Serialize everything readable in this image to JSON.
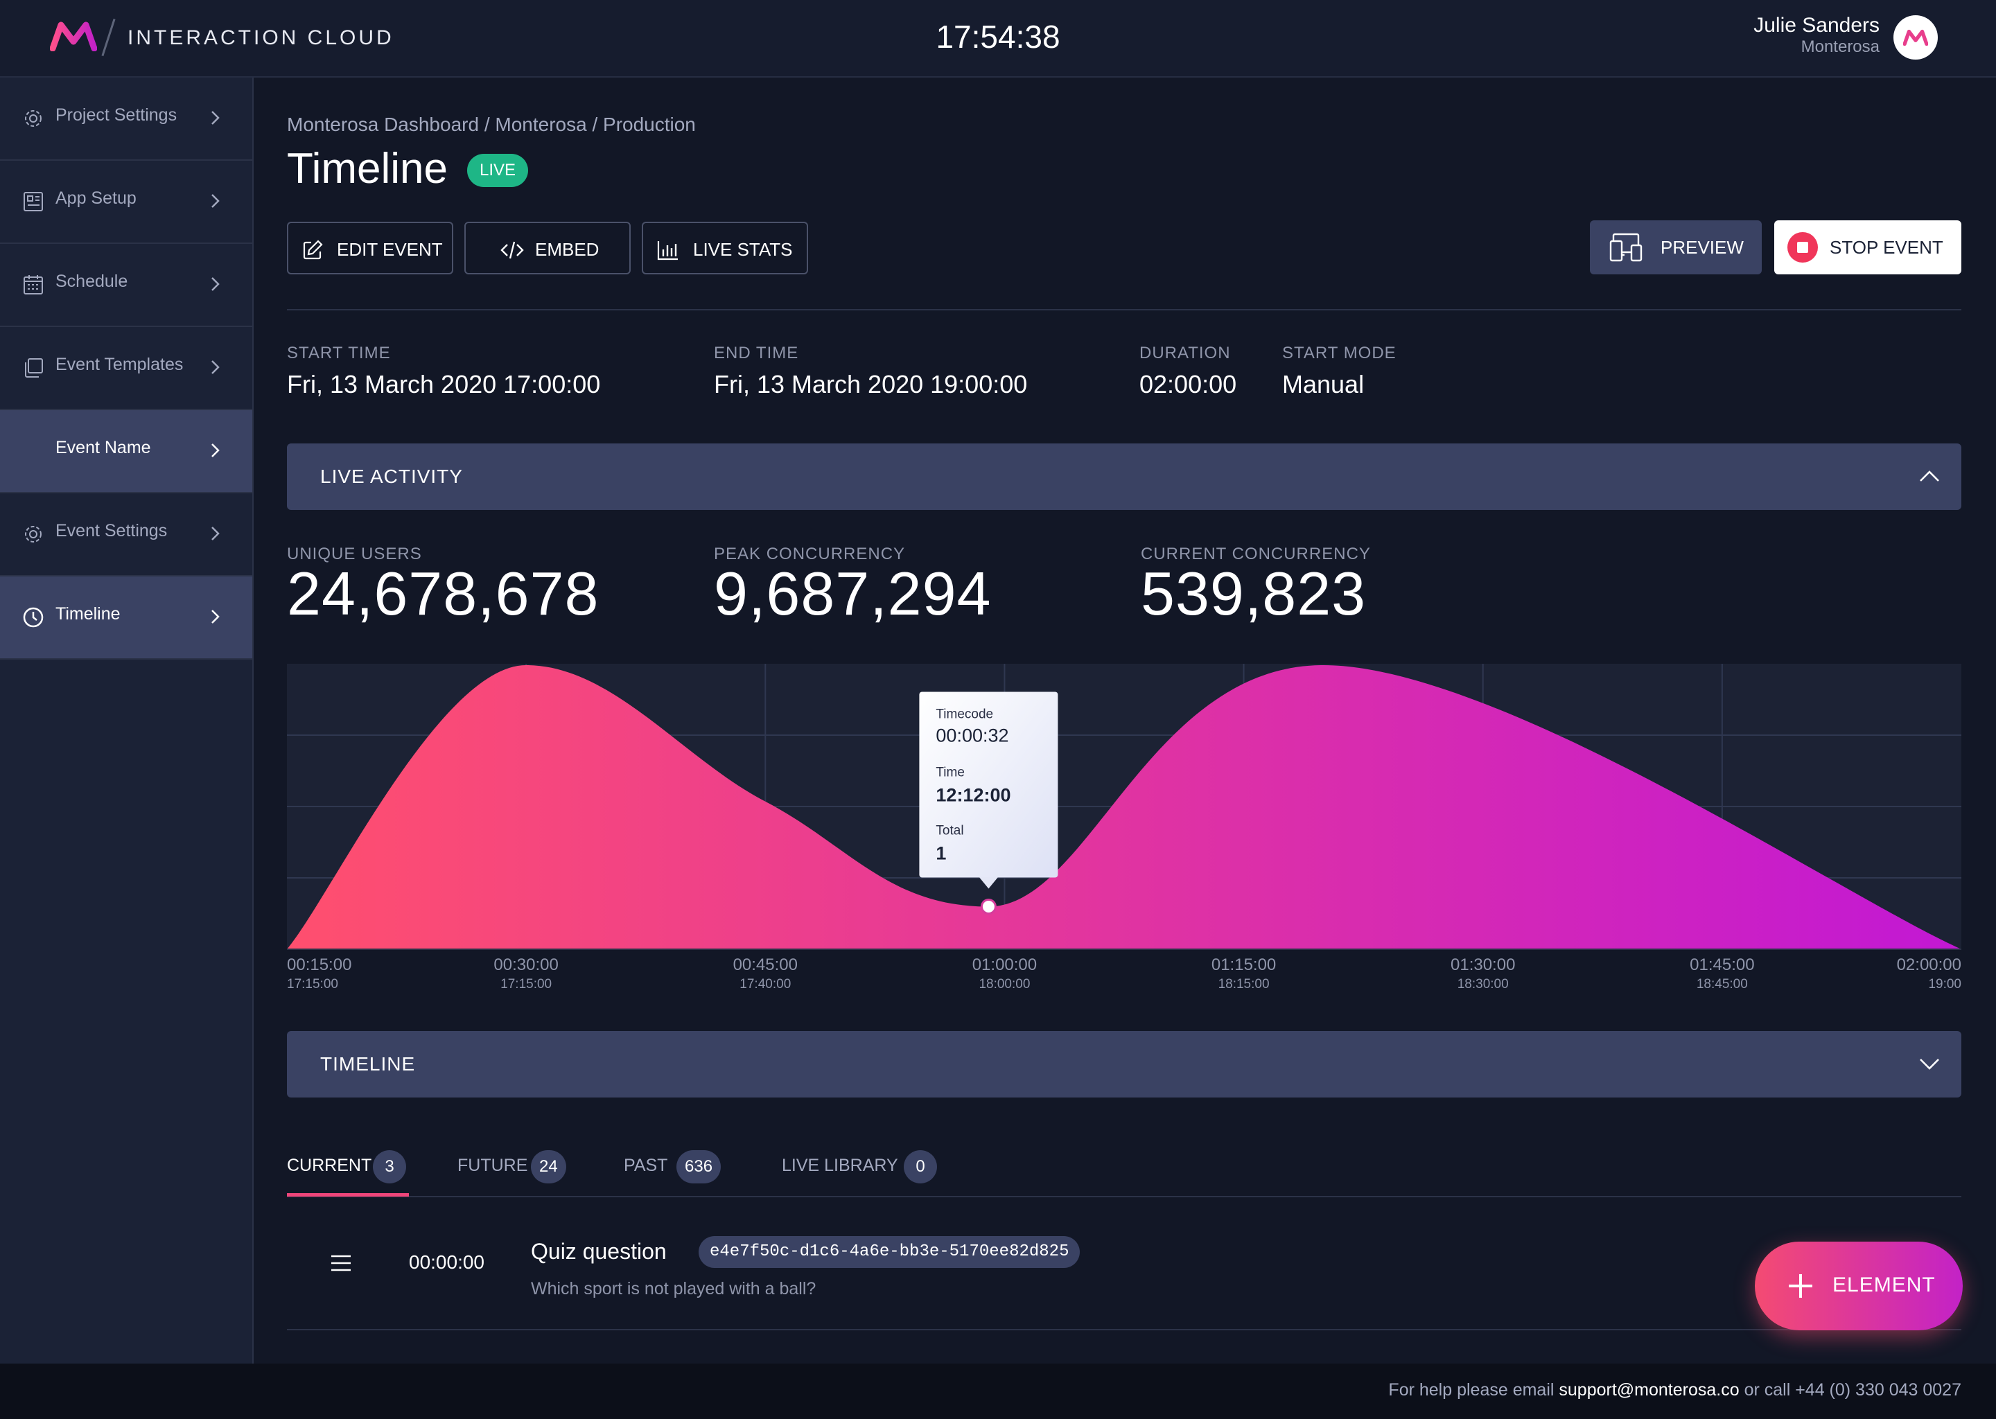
{
  "header": {
    "brand": "INTERACTION CLOUD",
    "clock": "17:54:38",
    "user_name": "Julie Sanders",
    "user_org": "Monterosa",
    "icons": {
      "logo": "monterosa-m-logo",
      "avatar": "monterosa-avatar"
    }
  },
  "sidebar": {
    "items": [
      {
        "label": "Project Settings",
        "icon": "gear-icon"
      },
      {
        "label": "App Setup",
        "icon": "app-setup-icon"
      },
      {
        "label": "Schedule",
        "icon": "calendar-icon"
      },
      {
        "label": "Event Templates",
        "icon": "templates-icon"
      },
      {
        "label": "Event Name",
        "icon": ""
      },
      {
        "label": "Event Settings",
        "icon": "gear-icon"
      },
      {
        "label": "Timeline",
        "icon": "clock-icon"
      }
    ]
  },
  "main": {
    "breadcrumb": "Monterosa Dashboard / Monterosa / Production",
    "title": "Timeline",
    "status_badge": "LIVE",
    "buttons": {
      "edit_event": "EDIT EVENT",
      "embed": "EMBED",
      "live_stats": "LIVE STATS",
      "preview": "PREVIEW",
      "stop_event": "STOP EVENT"
    },
    "meta": {
      "start_time_label": "START TIME",
      "start_time": "Fri, 13 March 2020 17:00:00",
      "end_time_label": "END TIME",
      "end_time": "Fri, 13 March 2020 19:00:00",
      "duration_label": "DURATION",
      "duration": "02:00:00",
      "start_mode_label": "START MODE",
      "start_mode": "Manual"
    },
    "live_activity": {
      "title": "LIVE ACTIVITY",
      "unique_users_label": "UNIQUE USERS",
      "unique_users": "24,678,678",
      "peak_label": "PEAK CONCURRENCY",
      "peak": "9,687,294",
      "current_label": "CURRENT CONCURRENCY",
      "current": "539,823"
    },
    "timeline_panel": {
      "title": "TIMELINE"
    },
    "tabs": [
      {
        "label": "CURRENT",
        "count": "3"
      },
      {
        "label": "FUTURE",
        "count": "24"
      },
      {
        "label": "PAST",
        "count": "636"
      },
      {
        "label": "LIVE LIBRARY",
        "count": "0"
      }
    ],
    "rows": [
      {
        "time": "00:00:00",
        "title": "Quiz question",
        "id": "e4e7f50c-d1c6-4a6e-bb3e-5170ee82d825",
        "subtitle": "Which sport is not played with a ball?"
      }
    ],
    "fab_label": "ELEMENT"
  },
  "chart_data": {
    "type": "area",
    "x_ticks": [
      {
        "label": "00:15:00",
        "sub": "17:15:00"
      },
      {
        "label": "00:30:00",
        "sub": "17:15:00"
      },
      {
        "label": "00:45:00",
        "sub": "17:40:00"
      },
      {
        "label": "01:00:00",
        "sub": "18:00:00"
      },
      {
        "label": "01:15:00",
        "sub": "18:15:00"
      },
      {
        "label": "01:30:00",
        "sub": "18:30:00"
      },
      {
        "label": "01:45:00",
        "sub": "18:45:00"
      },
      {
        "label": "02:00:00",
        "sub": "19:00"
      }
    ],
    "x_minutes": [
      15,
      30,
      45,
      60,
      75,
      90,
      105,
      120
    ],
    "series_relative": [
      {
        "x": 15,
        "y": 0
      },
      {
        "x": 30,
        "y": 1.0
      },
      {
        "x": 45,
        "y": 0.52
      },
      {
        "x": 59,
        "y": 0.15
      },
      {
        "x": 80,
        "y": 1.0
      },
      {
        "x": 120,
        "y": 0
      }
    ],
    "xlim": [
      15,
      120
    ],
    "ylim": [
      0,
      1
    ],
    "grid": true,
    "gradient": [
      "#ff4f6e",
      "#c218d4"
    ],
    "tooltip": {
      "timecode_label": "Timecode",
      "timecode": "00:00:32",
      "time_label": "Time",
      "time": "12:12:00",
      "total_label": "Total",
      "total": "1",
      "x": 59,
      "y": 0.15
    }
  },
  "footer": {
    "text_prefix": "For help please email ",
    "email": "support@monterosa.co",
    "text_suffix": " or call +44 (0) 330 043 0027"
  }
}
